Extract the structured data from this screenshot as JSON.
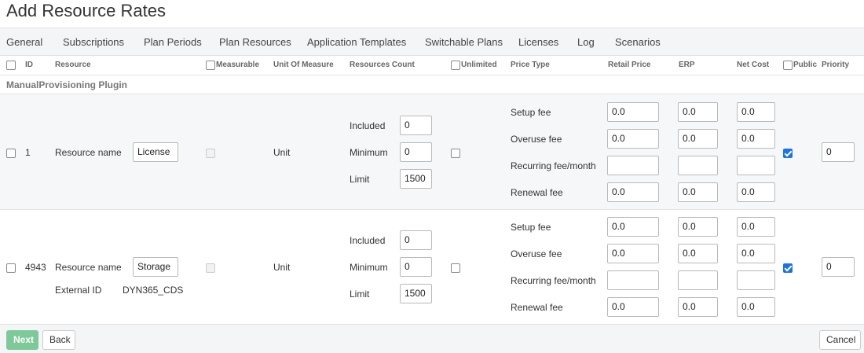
{
  "page_title": "Add Resource Rates",
  "tabs": [
    "General",
    "Subscriptions",
    "Plan Periods",
    "Plan Resources",
    "Application Templates",
    "Switchable Plans",
    "Licenses",
    "Log",
    "Scenarios"
  ],
  "columns": {
    "id": "ID",
    "resource": "Resource",
    "measurable": "Measurable",
    "unit_of_measure": "Unit Of Measure",
    "resources_count": "Resources Count",
    "unlimited": "Unlimited",
    "price_type": "Price Type",
    "retail_price": "Retail Price",
    "erp": "ERP",
    "net_cost": "Net Cost",
    "public": "Public",
    "priority": "Priority"
  },
  "group_title": "ManualProvisioning Plugin",
  "labels": {
    "resource_name": "Resource name",
    "external_id": "External ID",
    "included": "Included",
    "minimum": "Minimum",
    "limit": "Limit",
    "setup_fee": "Setup fee",
    "overuse_fee": "Overuse fee",
    "recurring_fee": "Recurring fee/month",
    "renewal_fee": "Renewal fee"
  },
  "rows": [
    {
      "id": "1",
      "resource_name": "License",
      "external_id": "",
      "unit": "Unit",
      "included": "0",
      "minimum": "0",
      "limit": "1500",
      "measurable": false,
      "unlimited": false,
      "public": true,
      "priority": "0",
      "setup_fee": {
        "retail": "0.0",
        "erp": "0.0",
        "net": "0.0"
      },
      "overuse_fee": {
        "retail": "0.0",
        "erp": "0.0",
        "net": "0.0"
      },
      "recurring_fee": {
        "retail": "",
        "erp": "",
        "net": ""
      },
      "renewal_fee": {
        "retail": "0.0",
        "erp": "0.0",
        "net": "0.0"
      }
    },
    {
      "id": "4943",
      "resource_name": "Storage",
      "external_id": "DYN365_CDS",
      "unit": "Unit",
      "included": "0",
      "minimum": "0",
      "limit": "1500",
      "measurable": false,
      "unlimited": false,
      "public": true,
      "priority": "0",
      "setup_fee": {
        "retail": "0.0",
        "erp": "0.0",
        "net": "0.0"
      },
      "overuse_fee": {
        "retail": "0.0",
        "erp": "0.0",
        "net": "0.0"
      },
      "recurring_fee": {
        "retail": "",
        "erp": "",
        "net": ""
      },
      "renewal_fee": {
        "retail": "0.0",
        "erp": "0.0",
        "net": "0.0"
      }
    }
  ],
  "buttons": {
    "next": "Next",
    "back": "Back",
    "cancel": "Cancel"
  },
  "colors": {
    "accent": "#1a73e8",
    "next_button": "#7ec99a"
  }
}
